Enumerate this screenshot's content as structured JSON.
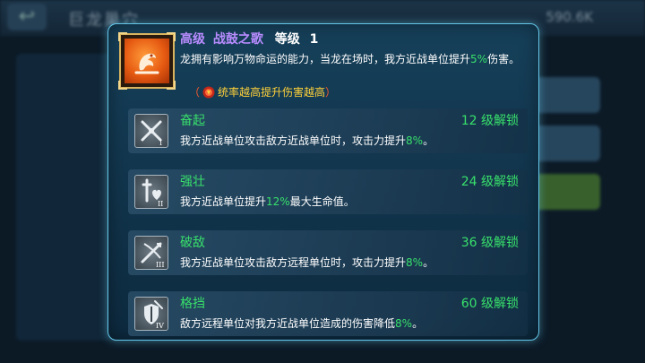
{
  "background": {
    "title": "巨龙巢穴",
    "score": "590.6K"
  },
  "skill": {
    "rank": "高级",
    "name": "战鼓之歌",
    "level_label": "等级",
    "level": "1",
    "desc_pre": "龙拥有影响万物命运的能力，当龙在场时，我方近战单位提升",
    "desc_value": "5%",
    "desc_post": "伤害。",
    "note_open": "（",
    "note_text": "统率越高提升伤害越高",
    "note_close": "）"
  },
  "tiers": [
    {
      "name": "奋起",
      "roman": "I",
      "unlock": "12 级解锁",
      "desc_pre": "我方近战单位攻击敌方近战单位时，攻击力提升",
      "desc_value": "8%",
      "desc_post": "。"
    },
    {
      "name": "强壮",
      "roman": "II",
      "unlock": "24 级解锁",
      "desc_pre": "我方近战单位提升",
      "desc_value": "12%",
      "desc_post": "最大生命值。"
    },
    {
      "name": "破敌",
      "roman": "III",
      "unlock": "36 级解锁",
      "desc_pre": "我方近战单位攻击敌方远程单位时，攻击力提升",
      "desc_value": "8%",
      "desc_post": "。"
    },
    {
      "name": "格挡",
      "roman": "IV",
      "unlock": "60 级解锁",
      "desc_pre": "敌方远程单位对我方近战单位造成的伤害降低",
      "desc_value": "8%",
      "desc_post": "。"
    }
  ],
  "colors": {
    "accent_purple": "#b98cff",
    "highlight_green": "#38e06b",
    "note_yellow": "#ffd23a"
  }
}
